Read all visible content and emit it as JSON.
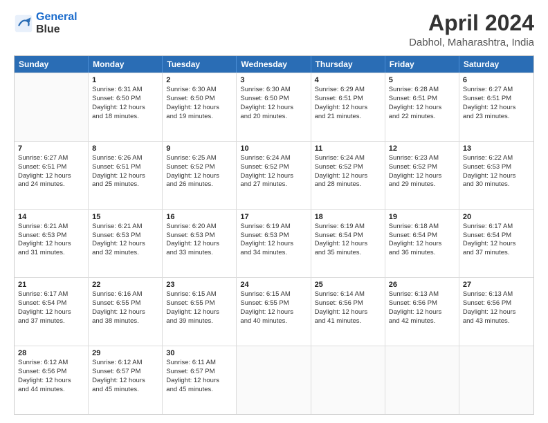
{
  "logo": {
    "line1": "General",
    "line2": "Blue"
  },
  "header": {
    "month_year": "April 2024",
    "location": "Dabhol, Maharashtra, India"
  },
  "weekdays": [
    "Sunday",
    "Monday",
    "Tuesday",
    "Wednesday",
    "Thursday",
    "Friday",
    "Saturday"
  ],
  "weeks": [
    [
      {
        "day": "",
        "info": ""
      },
      {
        "day": "1",
        "info": "Sunrise: 6:31 AM\nSunset: 6:50 PM\nDaylight: 12 hours\nand 18 minutes."
      },
      {
        "day": "2",
        "info": "Sunrise: 6:30 AM\nSunset: 6:50 PM\nDaylight: 12 hours\nand 19 minutes."
      },
      {
        "day": "3",
        "info": "Sunrise: 6:30 AM\nSunset: 6:50 PM\nDaylight: 12 hours\nand 20 minutes."
      },
      {
        "day": "4",
        "info": "Sunrise: 6:29 AM\nSunset: 6:51 PM\nDaylight: 12 hours\nand 21 minutes."
      },
      {
        "day": "5",
        "info": "Sunrise: 6:28 AM\nSunset: 6:51 PM\nDaylight: 12 hours\nand 22 minutes."
      },
      {
        "day": "6",
        "info": "Sunrise: 6:27 AM\nSunset: 6:51 PM\nDaylight: 12 hours\nand 23 minutes."
      }
    ],
    [
      {
        "day": "7",
        "info": "Sunrise: 6:27 AM\nSunset: 6:51 PM\nDaylight: 12 hours\nand 24 minutes."
      },
      {
        "day": "8",
        "info": "Sunrise: 6:26 AM\nSunset: 6:51 PM\nDaylight: 12 hours\nand 25 minutes."
      },
      {
        "day": "9",
        "info": "Sunrise: 6:25 AM\nSunset: 6:52 PM\nDaylight: 12 hours\nand 26 minutes."
      },
      {
        "day": "10",
        "info": "Sunrise: 6:24 AM\nSunset: 6:52 PM\nDaylight: 12 hours\nand 27 minutes."
      },
      {
        "day": "11",
        "info": "Sunrise: 6:24 AM\nSunset: 6:52 PM\nDaylight: 12 hours\nand 28 minutes."
      },
      {
        "day": "12",
        "info": "Sunrise: 6:23 AM\nSunset: 6:52 PM\nDaylight: 12 hours\nand 29 minutes."
      },
      {
        "day": "13",
        "info": "Sunrise: 6:22 AM\nSunset: 6:53 PM\nDaylight: 12 hours\nand 30 minutes."
      }
    ],
    [
      {
        "day": "14",
        "info": "Sunrise: 6:21 AM\nSunset: 6:53 PM\nDaylight: 12 hours\nand 31 minutes."
      },
      {
        "day": "15",
        "info": "Sunrise: 6:21 AM\nSunset: 6:53 PM\nDaylight: 12 hours\nand 32 minutes."
      },
      {
        "day": "16",
        "info": "Sunrise: 6:20 AM\nSunset: 6:53 PM\nDaylight: 12 hours\nand 33 minutes."
      },
      {
        "day": "17",
        "info": "Sunrise: 6:19 AM\nSunset: 6:53 PM\nDaylight: 12 hours\nand 34 minutes."
      },
      {
        "day": "18",
        "info": "Sunrise: 6:19 AM\nSunset: 6:54 PM\nDaylight: 12 hours\nand 35 minutes."
      },
      {
        "day": "19",
        "info": "Sunrise: 6:18 AM\nSunset: 6:54 PM\nDaylight: 12 hours\nand 36 minutes."
      },
      {
        "day": "20",
        "info": "Sunrise: 6:17 AM\nSunset: 6:54 PM\nDaylight: 12 hours\nand 37 minutes."
      }
    ],
    [
      {
        "day": "21",
        "info": "Sunrise: 6:17 AM\nSunset: 6:54 PM\nDaylight: 12 hours\nand 37 minutes."
      },
      {
        "day": "22",
        "info": "Sunrise: 6:16 AM\nSunset: 6:55 PM\nDaylight: 12 hours\nand 38 minutes."
      },
      {
        "day": "23",
        "info": "Sunrise: 6:15 AM\nSunset: 6:55 PM\nDaylight: 12 hours\nand 39 minutes."
      },
      {
        "day": "24",
        "info": "Sunrise: 6:15 AM\nSunset: 6:55 PM\nDaylight: 12 hours\nand 40 minutes."
      },
      {
        "day": "25",
        "info": "Sunrise: 6:14 AM\nSunset: 6:56 PM\nDaylight: 12 hours\nand 41 minutes."
      },
      {
        "day": "26",
        "info": "Sunrise: 6:13 AM\nSunset: 6:56 PM\nDaylight: 12 hours\nand 42 minutes."
      },
      {
        "day": "27",
        "info": "Sunrise: 6:13 AM\nSunset: 6:56 PM\nDaylight: 12 hours\nand 43 minutes."
      }
    ],
    [
      {
        "day": "28",
        "info": "Sunrise: 6:12 AM\nSunset: 6:56 PM\nDaylight: 12 hours\nand 44 minutes."
      },
      {
        "day": "29",
        "info": "Sunrise: 6:12 AM\nSunset: 6:57 PM\nDaylight: 12 hours\nand 45 minutes."
      },
      {
        "day": "30",
        "info": "Sunrise: 6:11 AM\nSunset: 6:57 PM\nDaylight: 12 hours\nand 45 minutes."
      },
      {
        "day": "",
        "info": ""
      },
      {
        "day": "",
        "info": ""
      },
      {
        "day": "",
        "info": ""
      },
      {
        "day": "",
        "info": ""
      }
    ]
  ]
}
